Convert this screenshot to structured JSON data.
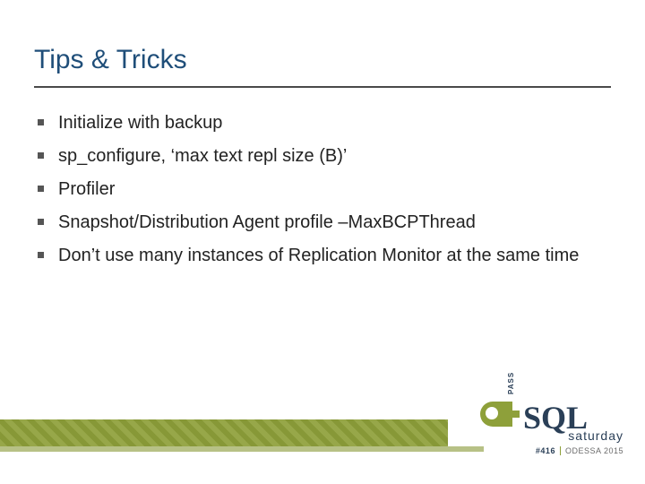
{
  "title": "Tips & Tricks",
  "bullets": [
    "Initialize with backup",
    "sp_configure, ‘max text repl size (B)’",
    "Profiler",
    "Snapshot/Distribution Agent profile –MaxBCPThread",
    "Don’t use many instances of  Replication Monitor at the same time"
  ],
  "logo": {
    "pass": "PASS",
    "sql": "SQL",
    "saturday": "saturday",
    "event_num": "#416",
    "event_loc": "ODESSA 2015"
  }
}
